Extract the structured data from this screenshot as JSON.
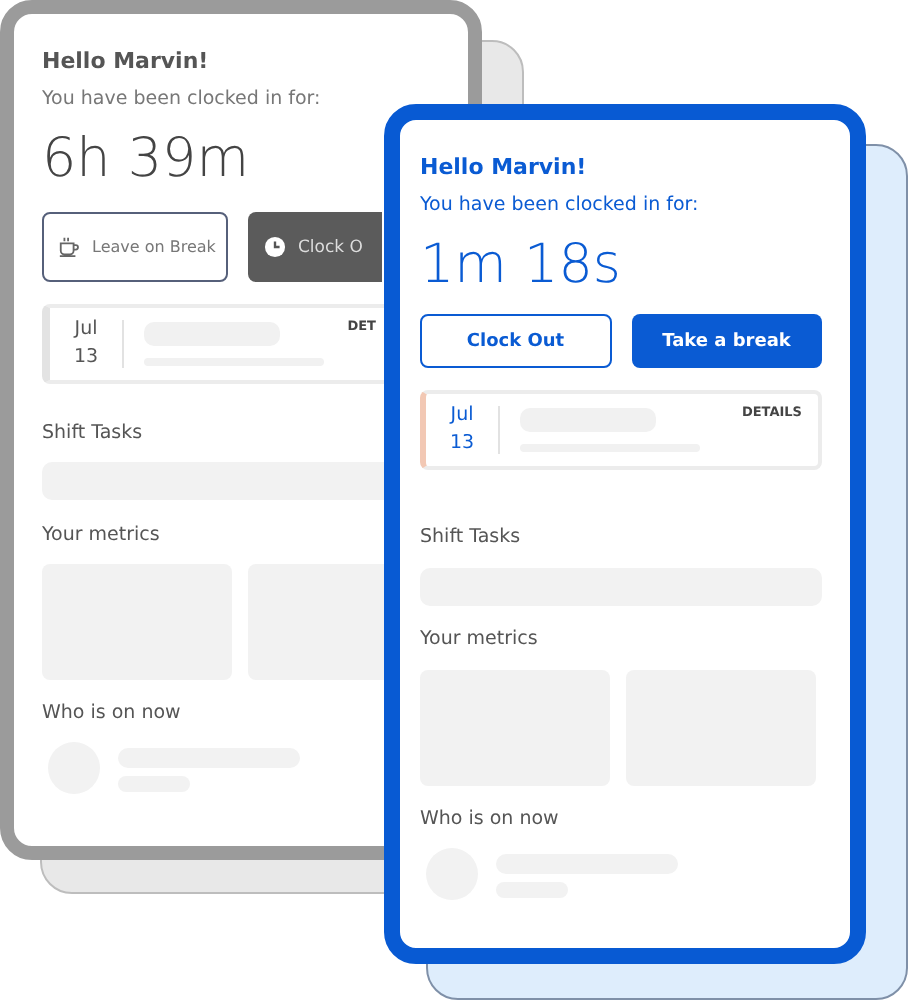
{
  "phones": [
    {
      "selected": false,
      "greeting": "Hello Marvin!",
      "subtitle": "You have been clocked in for:",
      "elapsed": "6h 39m",
      "buttons": [
        {
          "label": "Leave on Break",
          "kind": "outline",
          "has_icon": true
        },
        {
          "label": "Clock O",
          "kind": "filled",
          "has_icon": true
        }
      ],
      "shift": {
        "month": "Jul",
        "day": "13",
        "action": "DET"
      },
      "sections": [
        "Shift Tasks",
        "Your metrics",
        "Who is on now"
      ]
    },
    {
      "selected": true,
      "greeting": "Hello Marvin!",
      "subtitle": "You have been clocked in for:",
      "elapsed": "1m 18s",
      "buttons": [
        {
          "label": "Clock Out",
          "kind": "outline",
          "has_icon": false
        },
        {
          "label": "Take a break",
          "kind": "filled",
          "has_icon": false
        }
      ],
      "shift": {
        "month": "Jul",
        "day": "13",
        "action": "DETAILS"
      },
      "sections": [
        "Shift Tasks",
        "Your metrics",
        "Who is on now"
      ]
    }
  ]
}
